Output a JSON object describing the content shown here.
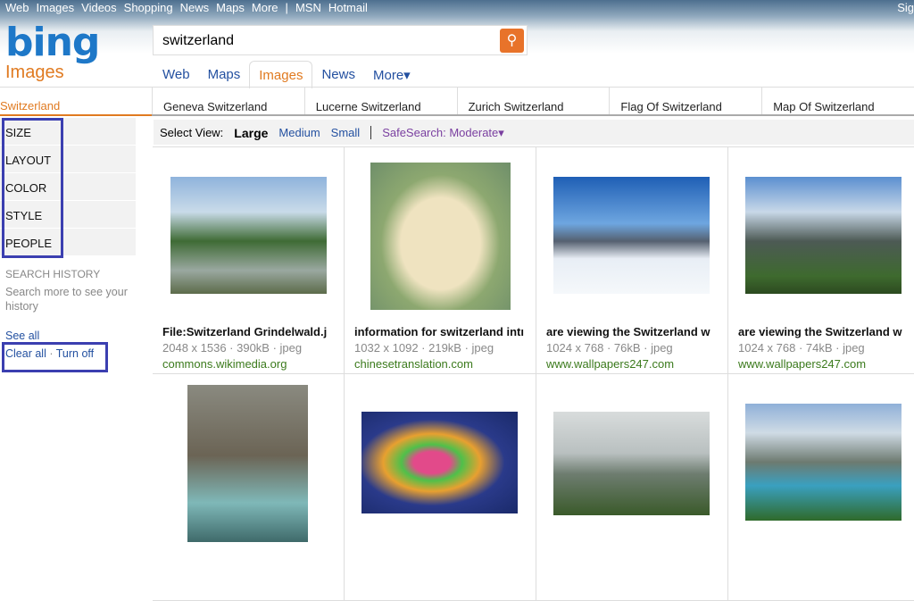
{
  "toplinks": [
    "Web",
    "Images",
    "Videos",
    "Shopping",
    "News",
    "Maps",
    "More",
    "|",
    "MSN",
    "Hotmail"
  ],
  "signin": "Sig",
  "logo": "bing",
  "vertical": "Images",
  "search": {
    "value": "switzerland"
  },
  "tabs": [
    {
      "label": "Web"
    },
    {
      "label": "Maps"
    },
    {
      "label": "Images",
      "active": true
    },
    {
      "label": "News"
    },
    {
      "label": "More▾"
    }
  ],
  "breadcrumb": "Switzerland",
  "related": [
    "Geneva Switzerland",
    "Lucerne Switzerland",
    "Zurich Switzerland",
    "Flag Of Switzerland",
    "Map Of Switzerland"
  ],
  "facets": [
    "SIZE",
    "LAYOUT",
    "COLOR",
    "STYLE",
    "PEOPLE"
  ],
  "history": {
    "title": "SEARCH HISTORY",
    "text1": "Search more to see your",
    "text2": "history",
    "see_all": "See all",
    "clear_all": "Clear all",
    "sep": "·",
    "turn_off": "Turn off"
  },
  "view": {
    "label": "Select View:",
    "large": "Large",
    "medium": "Medium",
    "small": "Small",
    "safesearch": "SafeSearch: Moderate▾"
  },
  "highlight_color": "#3b3fb0",
  "results": [
    {
      "title": "File:Switzerland Grindelwald.j",
      "meta": "2048 x 1536 · 390kB · jpeg",
      "source": "commons.wikimedia.org"
    },
    {
      "title": "information for switzerland intı",
      "meta": "1032 x 1092 · 219kB · jpeg",
      "source": "chinesetranslation.com"
    },
    {
      "title": "are viewing the Switzerland w",
      "meta": "1024 x 768 · 76kB · jpeg",
      "source": "www.wallpapers247.com"
    },
    {
      "title": "are viewing the Switzerland w",
      "meta": "1024 x 768 · 74kB · jpeg",
      "source": "www.wallpapers247.com"
    },
    {},
    {},
    {},
    {}
  ]
}
